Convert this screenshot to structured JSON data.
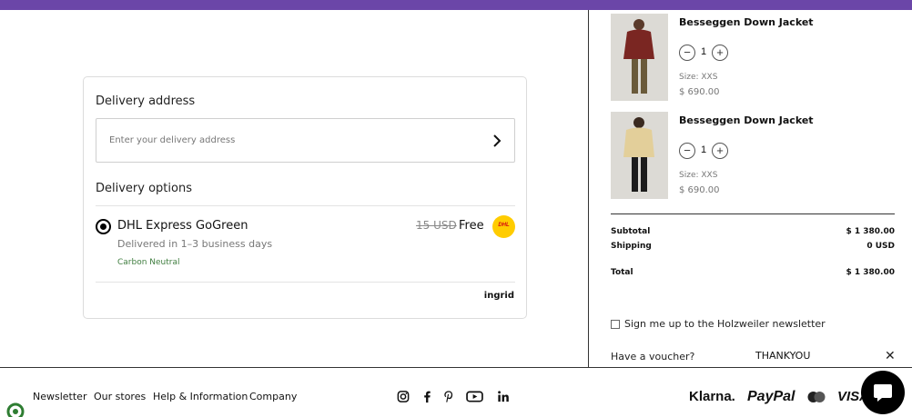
{
  "colors": {
    "accent": "#6b46a8",
    "dhl_yellow": "#ffcc00",
    "eco_green": "#3f7d3f"
  },
  "delivery": {
    "address_heading": "Delivery address",
    "address_placeholder": "Enter your delivery address",
    "options_heading": "Delivery options",
    "option": {
      "carrier": "DHL Express GoGreen",
      "eta": "Delivered in 1–3 business days",
      "badge": "Carbon Neutral",
      "old_price": "15 USD",
      "price": "Free",
      "logo_text": "DHL"
    },
    "powered_by": "ingrid"
  },
  "cart": {
    "items": [
      {
        "name": "Besseggen Down Jacket",
        "quantity": "1",
        "size": "Size: XXS",
        "price": "$ 690.00",
        "image_icon": "burgundy-jacket-model"
      },
      {
        "name": "Besseggen Down Jacket",
        "quantity": "1",
        "size": "Size: XXS",
        "price": "$ 690.00",
        "image_icon": "beige-jacket-model"
      }
    ],
    "summary": {
      "subtotal_label": "Subtotal",
      "subtotal": "$ 1 380.00",
      "shipping_label": "Shipping",
      "shipping": "0 USD",
      "total_label": "Total",
      "total": "$ 1 380.00"
    },
    "newsletter_label": "Sign me up to the Holzweiler newsletter",
    "voucher_label": "Have a voucher?",
    "voucher_code": "THANKYOU"
  },
  "footer": {
    "links": [
      "Newsletter",
      "Our stores",
      "Help & Information",
      "Company"
    ],
    "social_icons": [
      "instagram-icon",
      "facebook-icon",
      "pinterest-icon",
      "youtube-icon",
      "linkedin-icon"
    ],
    "payments": [
      "Klarna.",
      "PayPal",
      "VISA"
    ]
  }
}
